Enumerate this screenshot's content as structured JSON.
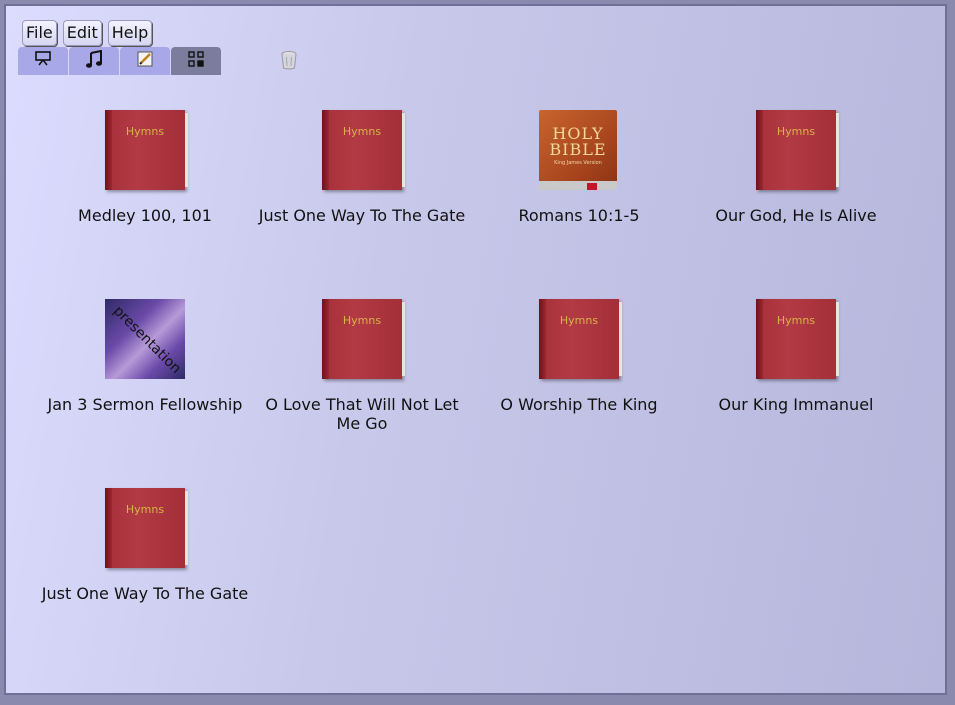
{
  "menu": [
    "File",
    "Edit",
    "Help"
  ],
  "tabs": [
    {
      "icon": "presentation-screen-icon",
      "active": false
    },
    {
      "icon": "music-note-icon",
      "active": false
    },
    {
      "icon": "edit-pencil-icon",
      "active": false
    },
    {
      "icon": "grid-view-icon",
      "active": true
    }
  ],
  "trash_icon": "trash-can-icon",
  "items": [
    {
      "label": "Medley 100, 101",
      "kind": "hymns"
    },
    {
      "label": "Just One Way To The Gate",
      "kind": "hymns"
    },
    {
      "label": "Romans 10:1-5",
      "kind": "bible"
    },
    {
      "label": "Our God, He Is Alive",
      "kind": "hymns"
    },
    {
      "label": "Jan 3 Sermon Fellowship",
      "kind": "presentation"
    },
    {
      "label": "O Love That Will Not Let Me Go",
      "kind": "hymns"
    },
    {
      "label": "O Worship The King",
      "kind": "hymns"
    },
    {
      "label": "Our King Immanuel",
      "kind": "hymns"
    },
    {
      "label": "Just One Way To The Gate",
      "kind": "hymns"
    }
  ],
  "thumb_text": {
    "hymns": "Hymns",
    "bible_line1": "HOLY",
    "bible_line2": "BIBLE",
    "bible_sub": "King James Version",
    "presentation": "presentation"
  },
  "colors": {
    "background": "#c8c8ea",
    "tab": "#a8a8e8",
    "tab_active": "#7c7c9c",
    "hymn_cover": "#b23a44",
    "hymn_title": "#d8b34a"
  }
}
